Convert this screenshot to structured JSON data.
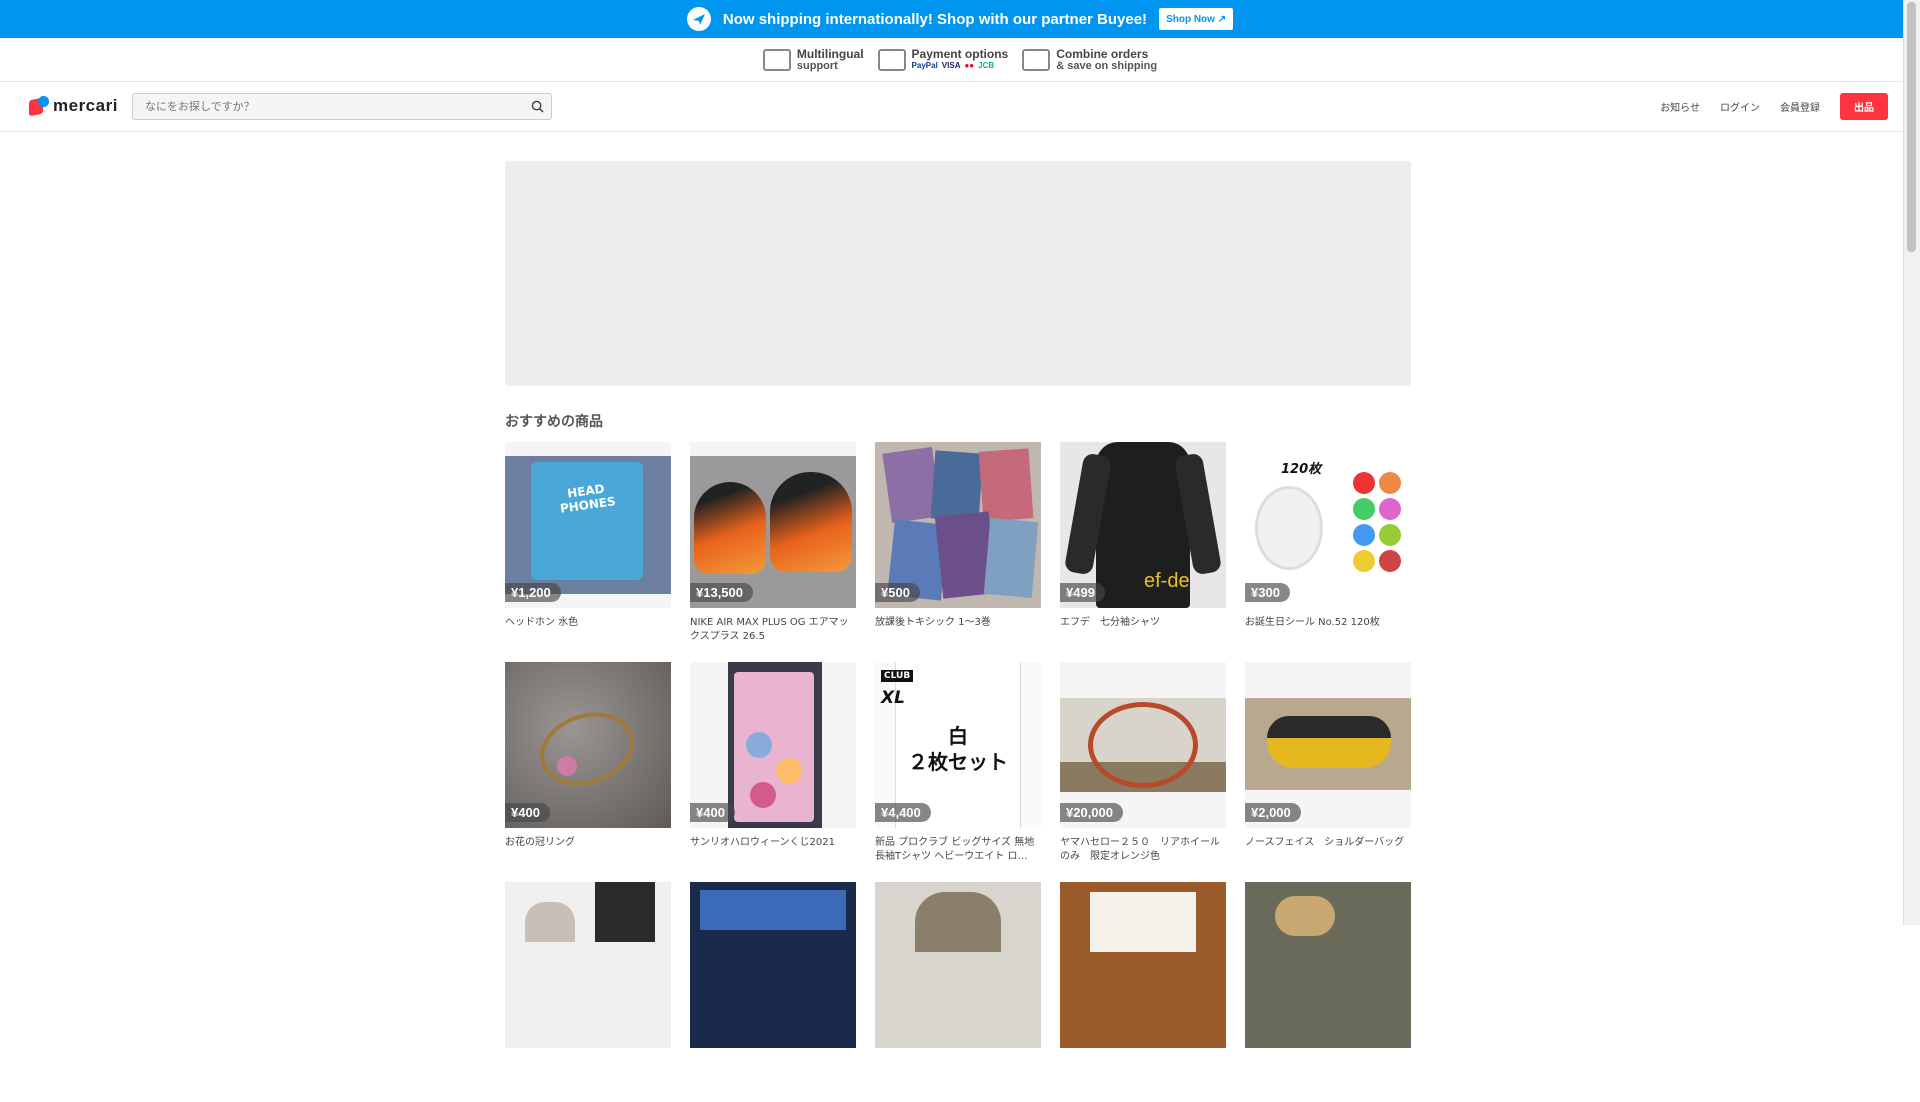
{
  "banner": {
    "message": "Now shipping internationally! Shop with our partner Buyee!",
    "button": "Shop Now ↗"
  },
  "features": [
    {
      "title": "Multilingual",
      "sub": "support",
      "icon": "translate-icon"
    },
    {
      "title": "Payment options",
      "sub": "",
      "icon": "card-icon",
      "cards": [
        "PayPal",
        "VISA",
        "●●",
        "JCB"
      ]
    },
    {
      "title": "Combine orders",
      "sub": "& save on shipping",
      "icon": "box-icon"
    }
  ],
  "header": {
    "logo": "mercari",
    "search_placeholder": "なにをお探しですか？",
    "nav": {
      "notifications": "お知らせ",
      "login": "ログイン",
      "signup": "会員登録",
      "sell": "出品"
    }
  },
  "section_title": "おすすめの商品",
  "products": [
    {
      "price": "¥1,200",
      "name": "ヘッドホン 水色",
      "color": "#4aa8d8",
      "bg": "#6c7fa0"
    },
    {
      "price": "¥13,500",
      "name": "NIKE AIR MAX PLUS OG エアマックスプラス 26.5",
      "color": "#e8621c",
      "bg": "#9a9a9a"
    },
    {
      "price": "¥500",
      "name": "放課後トキシック 1〜3巻",
      "color": "#8b6fa6",
      "bg": "#c0b8b0"
    },
    {
      "price": "¥499",
      "name": "エフデ　七分袖シャツ",
      "color": "#222",
      "bg": "#e8e6e6"
    },
    {
      "price": "¥300",
      "name": "お誕生日シール No.52 120枚",
      "color": "#e84",
      "bg": "#fff"
    },
    {
      "price": "¥400",
      "name": "お花の冠リング",
      "color": "#a07a3a",
      "bg": "#7d7a78"
    },
    {
      "price": "¥400",
      "name": "サンリオハロウィーンくじ2021",
      "color": "#d45a8a",
      "bg": "#f2f2f2"
    },
    {
      "price": "¥4,400",
      "name": "新品 プロクラブ ビッグサイズ 無地 長袖Tシャツ ヘビーウエイト ロ…",
      "color": "#fafafa",
      "bg": "#e8e8e8"
    },
    {
      "price": "¥20,000",
      "name": "ヤマハセロー２５０　リアホイールのみ　限定オレンジ色",
      "color": "#b84a2a",
      "bg": "#d8d4cc"
    },
    {
      "price": "¥2,000",
      "name": "ノースフェイス　ショルダーバッグ",
      "color": "#e6b820",
      "bg": "#b8a890"
    }
  ],
  "thumb_overlays": {
    "p1": "HEAD PHONES",
    "p4": "ef-de",
    "p5": "120枚",
    "p8_top": "CLUB",
    "p8_size": "XL",
    "p8_text1": "白",
    "p8_text2": "２枚セット"
  }
}
